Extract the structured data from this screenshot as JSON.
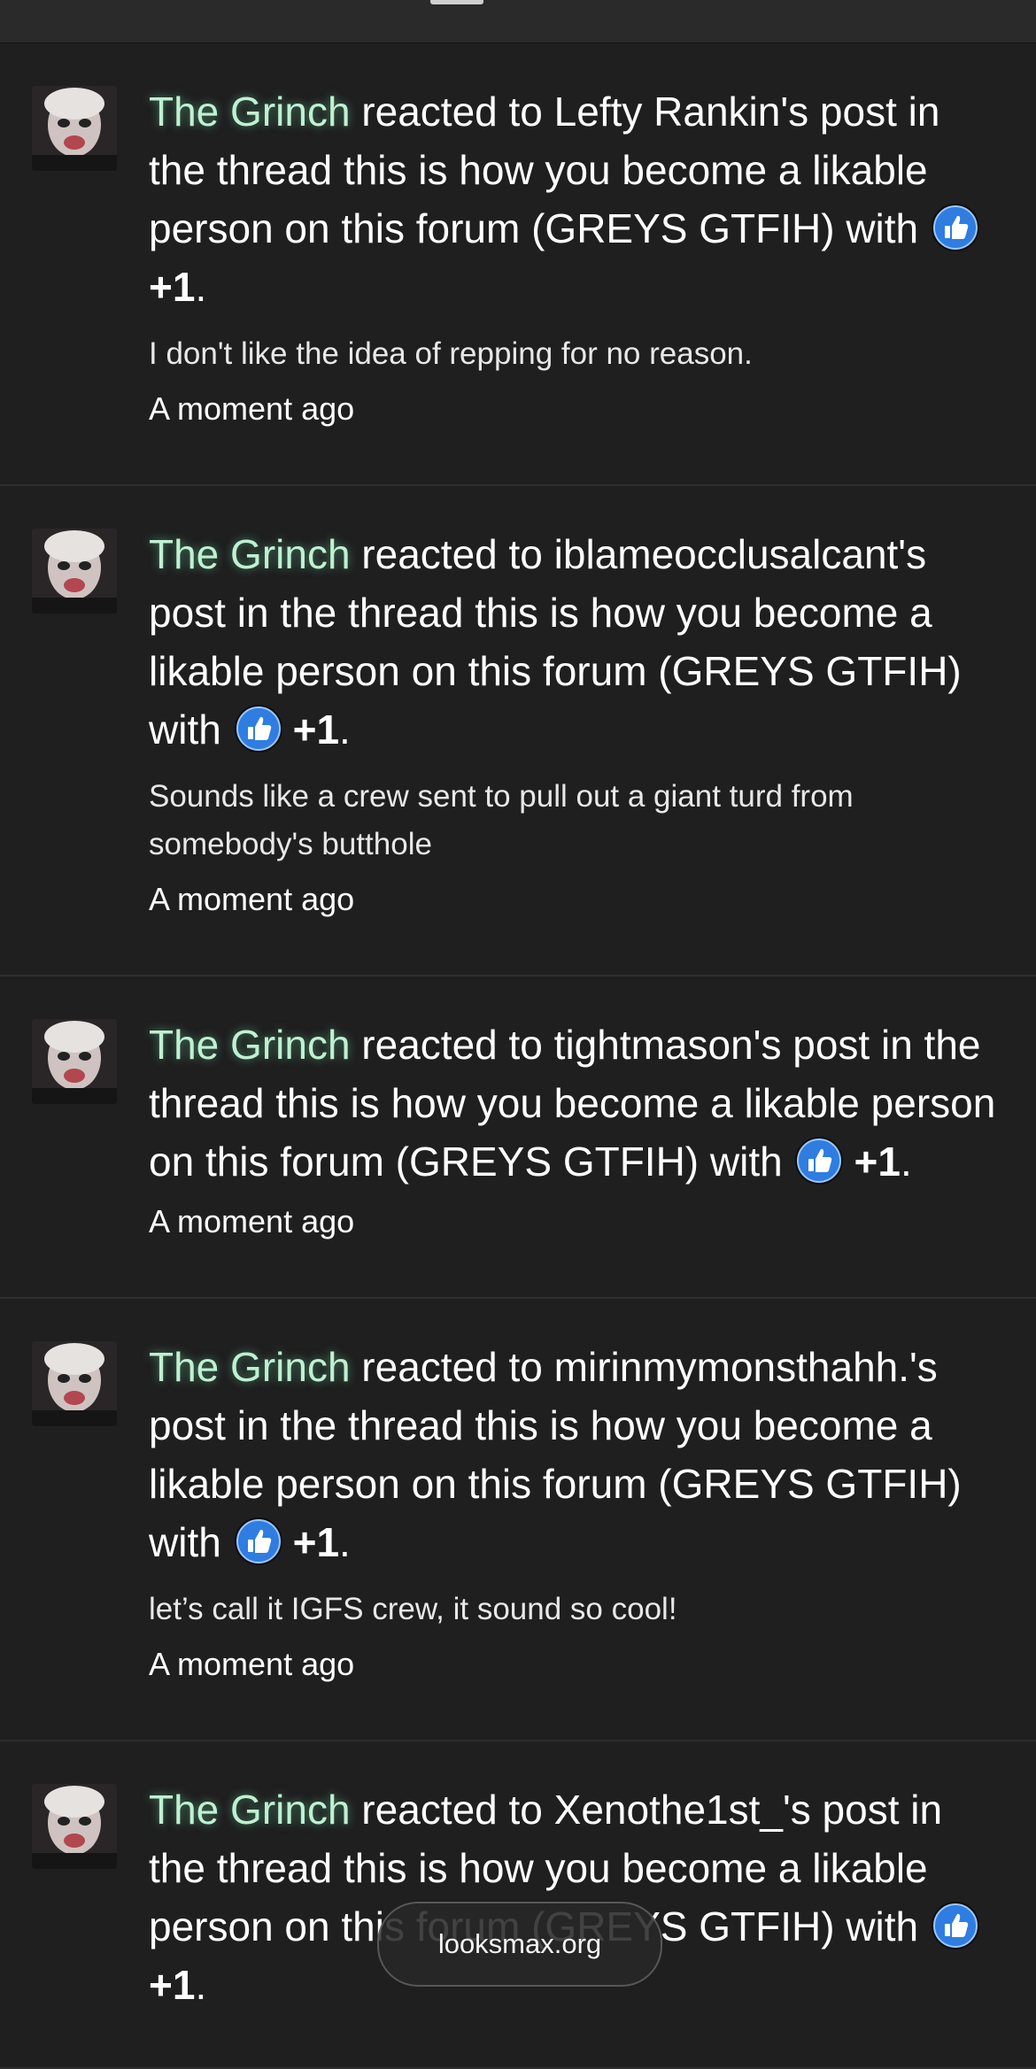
{
  "watermark": "looksmax.org",
  "icons": {
    "reaction": "thumbs-up-icon",
    "avatar": "user-avatar"
  },
  "colors": {
    "background": "#1f1f1f",
    "username": "#bff0d2",
    "reaction_blue": "#2f7de1"
  },
  "alerts": [
    {
      "user": "The Grinch",
      "text_before": " reacted to Lefty Rankin's post in the thread this is how you become a likable person on this forum (GREYS GTFIH) with ",
      "reaction": "+1",
      "text_after": ".",
      "snippet": "I don't like the idea of repping for no reason.",
      "time": "A moment ago"
    },
    {
      "user": "The Grinch",
      "text_before": " reacted to iblameocclusalcant's post in the thread this is how you become a likable person on this forum (GREYS GTFIH) with ",
      "reaction": "+1",
      "text_after": ".",
      "snippet": "Sounds like a crew sent to pull out a giant turd from somebody's butthole",
      "time": "A moment ago"
    },
    {
      "user": "The Grinch",
      "text_before": " reacted to tightmason's post in the thread this is how you become a likable person on this forum (GREYS GTFIH) with ",
      "reaction": "+1",
      "text_after": ".",
      "snippet": "",
      "time": "A moment ago"
    },
    {
      "user": "The Grinch",
      "text_before": " reacted to mirinmymonsthahh.'s post in the thread this is how you become a likable person on this forum (GREYS GTFIH) with ",
      "reaction": "+1",
      "text_after": ".",
      "snippet": "let’s call it IGFS crew, it sound so cool!",
      "time": "A moment ago"
    },
    {
      "user": "The Grinch",
      "text_before": " reacted to Xenothe1st_'s post in the thread this is how you become a likable person on this forum (GREYS GTFIH) with ",
      "reaction": "+1",
      "text_after": ".",
      "snippet": "",
      "time": ""
    }
  ]
}
